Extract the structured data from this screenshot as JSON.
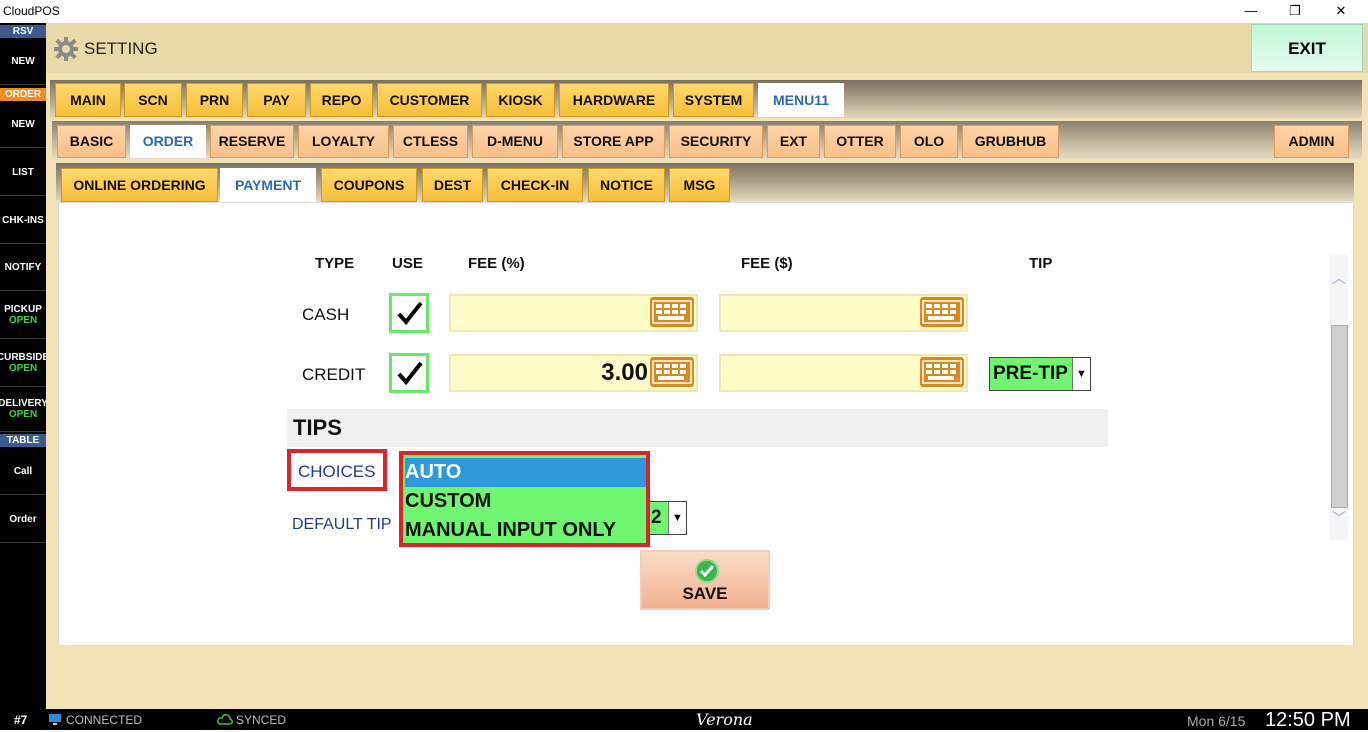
{
  "window": {
    "title": "CloudPOS",
    "minimize": "—",
    "restore": "❐",
    "close": "✕"
  },
  "sidebar": {
    "rsv_header": "RSV",
    "rsv_new": "NEW",
    "order_header": "ORDER",
    "order_new": "NEW",
    "list": "LIST",
    "chkins": "CHK-INS",
    "notify": "NOTIFY",
    "pickup": {
      "label": "PICKUP",
      "status": "OPEN"
    },
    "curbside": {
      "label": "CURBSIDE",
      "status": "OPEN"
    },
    "delivery": {
      "label": "DELIVERY",
      "status": "OPEN"
    },
    "table_header": "TABLE",
    "call": "Call",
    "order": "Order"
  },
  "header": {
    "title": "SETTING",
    "exit": "EXIT"
  },
  "tabs_main": [
    "MAIN",
    "SCN",
    "PRN",
    "PAY",
    "REPO",
    "CUSTOMER",
    "KIOSK",
    "HARDWARE",
    "SYSTEM",
    "MENU11"
  ],
  "tabs_main_active": "MENU11",
  "tabs_sub": [
    "BASIC",
    "ORDER",
    "RESERVE",
    "LOYALTY",
    "CTLESS",
    "D-MENU",
    "STORE APP",
    "SECURITY",
    "EXT",
    "OTTER",
    "OLO",
    "GRUBHUB"
  ],
  "tabs_sub_active": "ORDER",
  "tab_admin": "ADMIN",
  "tabs_third": [
    "ONLINE ORDERING",
    "PAYMENT",
    "COUPONS",
    "DEST",
    "CHECK-IN",
    "NOTICE",
    "MSG"
  ],
  "tabs_third_active": "PAYMENT",
  "payment": {
    "col_type": "TYPE",
    "col_use": "USE",
    "col_fee_pct": "FEE (%)",
    "col_fee_usd": "FEE ($)",
    "col_tip": "TIP",
    "rows": [
      {
        "type": "CASH",
        "use": true,
        "fee_pct": "",
        "fee_usd": ""
      },
      {
        "type": "CREDIT",
        "use": true,
        "fee_pct": "3.00",
        "fee_usd": "",
        "tip": "PRE-TIP"
      }
    ]
  },
  "tips": {
    "section": "TIPS",
    "choices_label": "CHOICES",
    "default_label": "DEFAULT TIP",
    "default_value": "2",
    "options": [
      "AUTO",
      "CUSTOM",
      "MANUAL INPUT ONLY"
    ],
    "selected": "AUTO"
  },
  "save": "SAVE",
  "status": {
    "station": "#7",
    "connected": "CONNECTED",
    "synced": "SYNCED",
    "store": "Verona",
    "date": "Mon 6/15",
    "time": "12:50 PM"
  },
  "colors": {
    "accent_tab": "#f6be3b",
    "active_text": "#2a6ab3",
    "select_green": "#6ff56f",
    "highlight_red": "#d8242b"
  }
}
